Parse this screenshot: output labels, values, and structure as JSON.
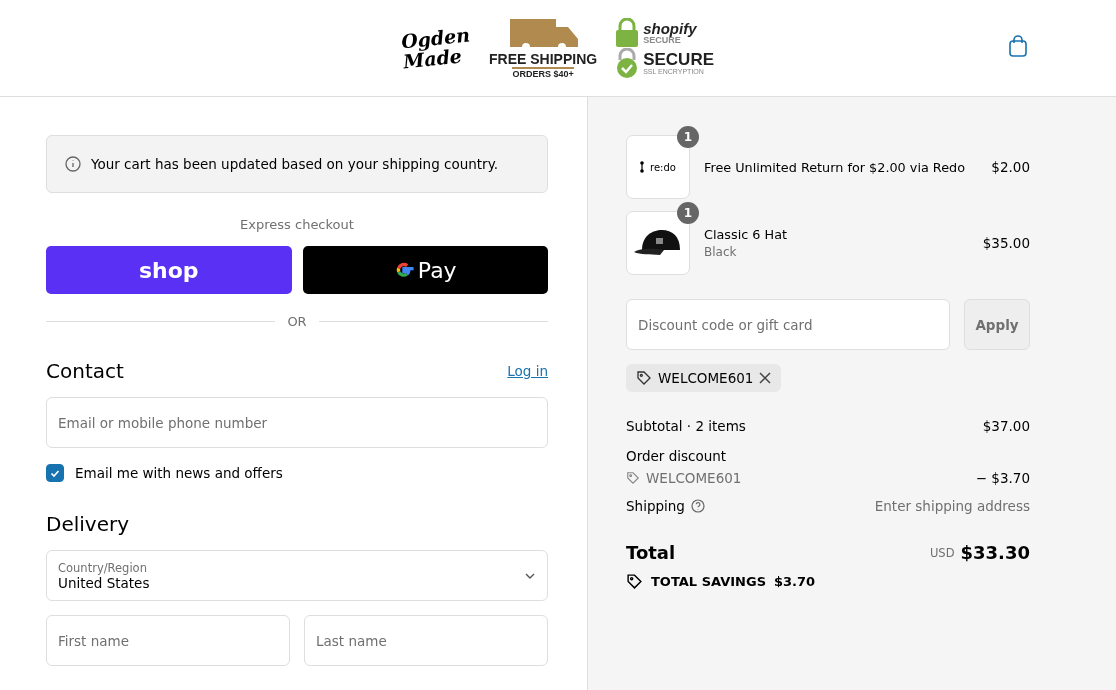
{
  "header": {
    "brand": {
      "line_1": "Ogden",
      "line_2": "Made"
    },
    "shipping_badge": {
      "title": "FREE SHIPPING",
      "subtitle": "ORDERS $40+"
    },
    "secure_badge": {
      "top_brand": "shopify",
      "top_label": "SECURE",
      "main": "SECURE",
      "sub": "SSL ENCRYPTION"
    }
  },
  "notice": "Your cart has been updated based on your shipping country.",
  "express": {
    "title": "Express checkout",
    "buttons": [
      {
        "kind": "shop",
        "label": "shop"
      },
      {
        "kind": "gpay",
        "label": "Pay"
      }
    ],
    "divider": "OR"
  },
  "contact": {
    "title": "Contact",
    "login": "Log in",
    "email_placeholder": "Email or mobile phone number",
    "newsletter": {
      "label": "Email me with news and offers",
      "checked": true
    }
  },
  "delivery": {
    "title": "Delivery",
    "country": {
      "label": "Country/Region",
      "value": "United States"
    },
    "first_name_placeholder": "First name",
    "last_name_placeholder": "Last name"
  },
  "cart": {
    "items": [
      {
        "kind": "redo",
        "thumb_text": "re:do",
        "quantity": "1",
        "name": "Free Unlimited Return for $2.00 via Redo",
        "price": "$2.00"
      },
      {
        "kind": "hat",
        "quantity": "1",
        "name": "Classic 6 Hat",
        "variant": "Black",
        "price": "$35.00"
      }
    ],
    "discount": {
      "placeholder": "Discount code or gift card",
      "apply": "Apply",
      "applied_code": "WELCOME601"
    },
    "summary": {
      "subtotal_label": "Subtotal · 2 items",
      "subtotal": "$37.00",
      "order_discount_label": "Order discount",
      "discount_code": "WELCOME601",
      "discount_amount": "− $3.70",
      "shipping_label": "Shipping",
      "shipping_value": "Enter shipping address",
      "total_label": "Total",
      "currency": "USD",
      "total": "$33.30",
      "savings_label": "TOTAL SAVINGS",
      "savings": "$3.70"
    }
  }
}
